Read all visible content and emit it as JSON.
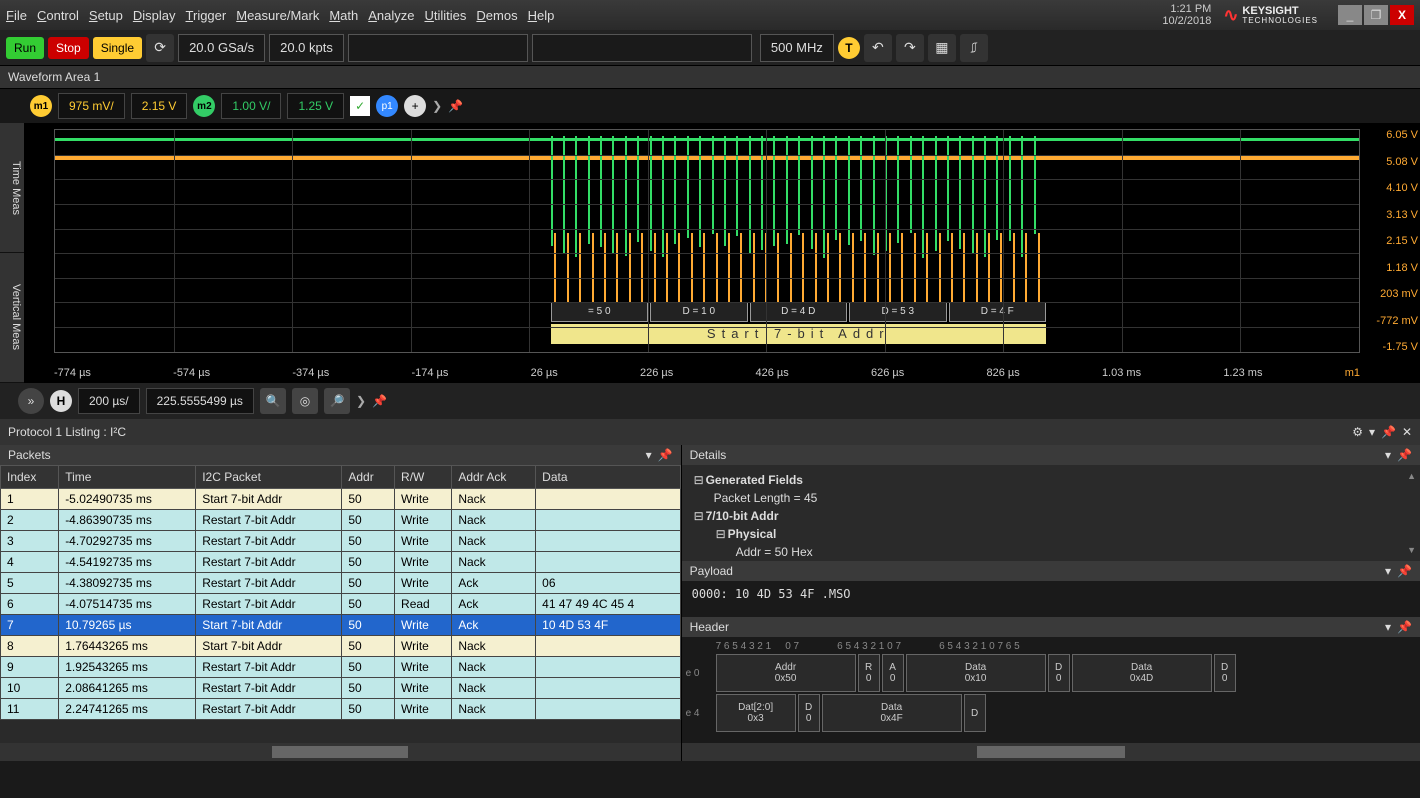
{
  "titlebar": {
    "menu": [
      "File",
      "Control",
      "Setup",
      "Display",
      "Trigger",
      "Measure/Mark",
      "Math",
      "Analyze",
      "Utilities",
      "Demos",
      "Help"
    ],
    "time": "1:21 PM",
    "date": "10/2/2018",
    "brand_top": "KEYSIGHT",
    "brand_bottom": "TECHNOLOGIES"
  },
  "toolbar": {
    "run": "Run",
    "stop": "Stop",
    "single": "Single",
    "sample_rate": "20.0 GSa/s",
    "points": "20.0 kpts",
    "bandwidth": "500 MHz",
    "trigger_letter": "T"
  },
  "waveform": {
    "area_title": "Waveform Area 1",
    "ch1_badge": "m1",
    "ch1_scale": "975 mV/",
    "ch1_offset": "2.15 V",
    "ch2_badge": "m2",
    "ch2_scale": "1.00 V/",
    "ch2_offset": "1.25 V",
    "marker_p1": "p1"
  },
  "side_tabs": [
    "Time Meas",
    "Vertical Meas"
  ],
  "y_axis": [
    "6.05 V",
    "5.08 V",
    "4.10 V",
    "3.13 V",
    "2.15 V",
    "1.18 V",
    "203 mV",
    "-772 mV",
    "-1.75 V"
  ],
  "x_axis": [
    "-774 µs",
    "-574 µs",
    "-374 µs",
    "-174 µs",
    "26 µs",
    "226 µs",
    "426 µs",
    "626 µs",
    "826 µs",
    "1.03 ms",
    "1.23 ms"
  ],
  "x_axis_suffix": "m1",
  "decode_segments": [
    "= 5 0",
    "D = 1 0",
    "D = 4 D",
    "D = 5 3",
    "D = 4 F"
  ],
  "decode_label": "Start 7-bit Addr",
  "timebar": {
    "h_label": "H",
    "scale": "200 µs/",
    "position": "225.5555499 µs"
  },
  "protocol": {
    "title": "Protocol 1 Listing : I²C",
    "packets_label": "Packets",
    "columns": [
      "Index",
      "Time",
      "I2C Packet",
      "Addr",
      "R/W",
      "Addr Ack",
      "Data"
    ],
    "rows": [
      {
        "style": "yellow",
        "cells": [
          "1",
          "-5.02490735 ms",
          "Start 7-bit Addr",
          "50",
          "Write",
          "Nack",
          ""
        ]
      },
      {
        "style": "cyan",
        "cells": [
          "2",
          "-4.86390735 ms",
          "Restart 7-bit Addr",
          "50",
          "Write",
          "Nack",
          ""
        ]
      },
      {
        "style": "cyan",
        "cells": [
          "3",
          "-4.70292735 ms",
          "Restart 7-bit Addr",
          "50",
          "Write",
          "Nack",
          ""
        ]
      },
      {
        "style": "cyan",
        "cells": [
          "4",
          "-4.54192735 ms",
          "Restart 7-bit Addr",
          "50",
          "Write",
          "Nack",
          ""
        ]
      },
      {
        "style": "cyan",
        "cells": [
          "5",
          "-4.38092735 ms",
          "Restart 7-bit Addr",
          "50",
          "Write",
          "Ack",
          "06"
        ]
      },
      {
        "style": "cyan",
        "cells": [
          "6",
          "-4.07514735 ms",
          "Restart 7-bit Addr",
          "50",
          "Read",
          "Ack",
          "41 47 49 4C 45 4"
        ]
      },
      {
        "style": "selected",
        "cells": [
          "7",
          "10.79265 µs",
          "Start 7-bit Addr",
          "50",
          "Write",
          "Ack",
          "10 4D 53 4F"
        ]
      },
      {
        "style": "yellow",
        "cells": [
          "8",
          "1.76443265 ms",
          "Start 7-bit Addr",
          "50",
          "Write",
          "Nack",
          ""
        ]
      },
      {
        "style": "cyan",
        "cells": [
          "9",
          "1.92543265 ms",
          "Restart 7-bit Addr",
          "50",
          "Write",
          "Nack",
          ""
        ]
      },
      {
        "style": "cyan",
        "cells": [
          "10",
          "2.08641265 ms",
          "Restart 7-bit Addr",
          "50",
          "Write",
          "Nack",
          ""
        ]
      },
      {
        "style": "cyan",
        "cells": [
          "11",
          "2.24741265 ms",
          "Restart 7-bit Addr",
          "50",
          "Write",
          "Nack",
          ""
        ]
      }
    ]
  },
  "details": {
    "title": "Details",
    "generated_fields": "Generated Fields",
    "packet_length": "Packet Length = 45",
    "addr_header": "7/10-bit Addr",
    "physical": "Physical",
    "addr_value": "Addr = 50 Hex"
  },
  "payload": {
    "title": "Payload",
    "row": "0000:   10 4D 53 4F    .MSO"
  },
  "header": {
    "title": "Header",
    "bits1": "7 6 5 4 3 2 1",
    "bits2": "0 7",
    "bits3": "6 5 4 3 2 1 0 7",
    "bits4": "6 5 4 3 2 1 0 7 6 5",
    "row1": [
      {
        "label": "e 0"
      },
      {
        "w": 140,
        "top": "Addr",
        "bot": "0x50"
      },
      {
        "w": 22,
        "top": "R",
        "bot": "0"
      },
      {
        "w": 22,
        "top": "A",
        "bot": "0"
      },
      {
        "w": 140,
        "top": "Data",
        "bot": "0x10"
      },
      {
        "w": 22,
        "top": "D",
        "bot": "0"
      },
      {
        "w": 140,
        "top": "Data",
        "bot": "0x4D"
      },
      {
        "w": 22,
        "top": "D",
        "bot": "0"
      }
    ],
    "row2": [
      {
        "label": "e 4"
      },
      {
        "w": 80,
        "top": "Dat[2:0]",
        "bot": "0x3"
      },
      {
        "w": 22,
        "top": "D",
        "bot": "0"
      },
      {
        "w": 140,
        "top": "Data",
        "bot": "0x4F"
      },
      {
        "w": 22,
        "top": "D",
        "bot": ""
      }
    ]
  }
}
